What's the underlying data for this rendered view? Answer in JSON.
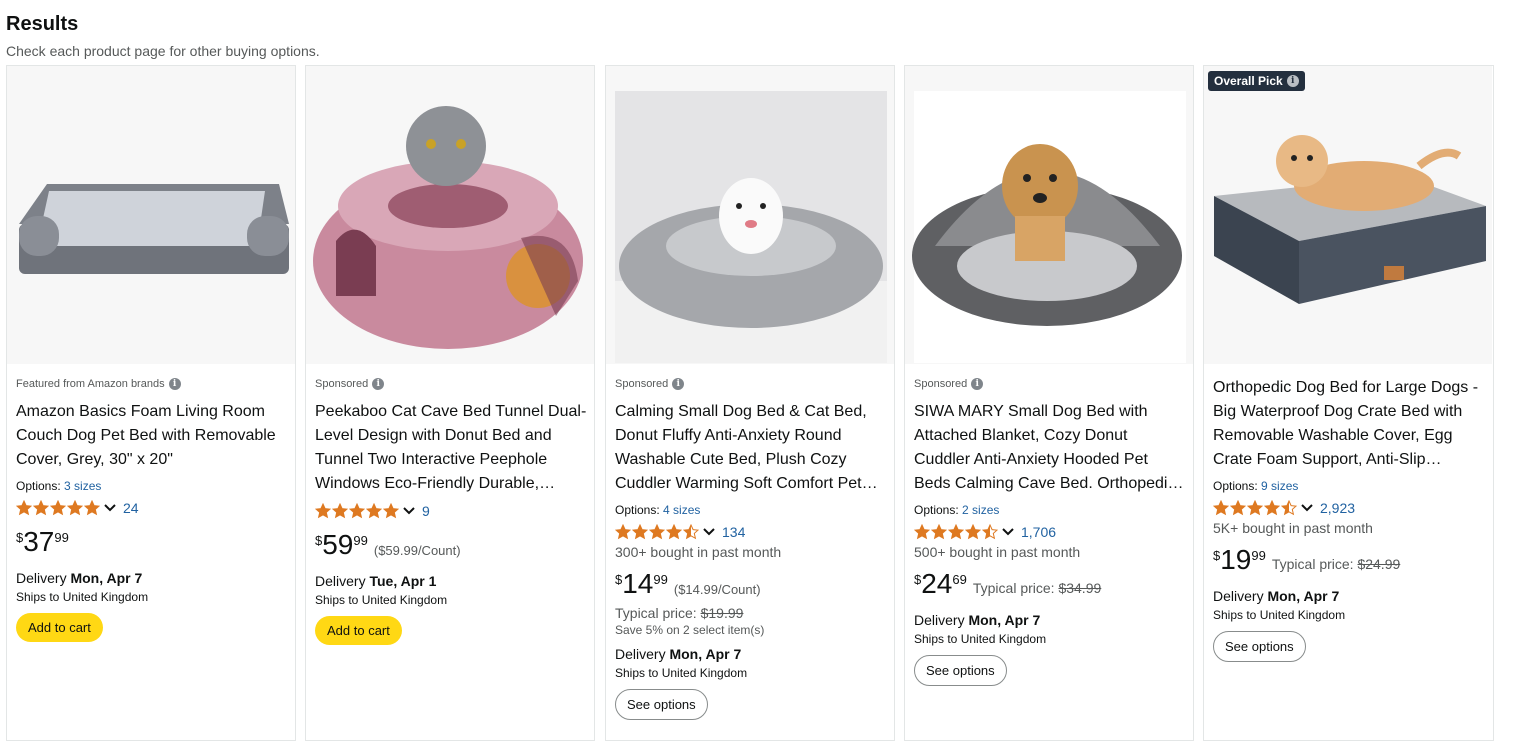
{
  "header": {
    "title": "Results",
    "subtitle": "Check each product page for other buying options."
  },
  "colors": {
    "star": "#de7921",
    "link": "#2162a1",
    "cart_button": "#ffd814",
    "badge": "#232f3e"
  },
  "products": [
    {
      "tag": "Featured from Amazon brands",
      "title": "Amazon Basics Foam Living Room Couch Dog Pet Bed with Removable Cover, Grey, 30\" x 20\"",
      "options_label": "Options:",
      "options_link": "3 sizes",
      "rating": 5,
      "review_count": "24",
      "price_symbol": "$",
      "price_whole": "37",
      "price_fraction": "99",
      "delivery_label": "Delivery",
      "delivery_date": "Mon, Apr 7",
      "ships": "Ships to United Kingdom",
      "button": "Add to cart",
      "image": "grey-foam-couch-dog-bed-image"
    },
    {
      "tag": "Sponsored",
      "title": "Peekaboo Cat Cave Bed Tunnel Dual-Level Design with Donut Bed and Tunnel Two Interactive Peephole Windows Eco-Friendly Durable, Eas…",
      "rating": 5,
      "review_count": "9",
      "price_symbol": "$",
      "price_whole": "59",
      "price_fraction": "99",
      "unit_price": "($59.99/Count)",
      "delivery_label": "Delivery",
      "delivery_date": "Tue, Apr 1",
      "ships": "Ships to United Kingdom",
      "button": "Add to cart",
      "image": "pink-cat-cave-bed-image"
    },
    {
      "tag": "Sponsored",
      "title": "Calming Small Dog Bed & Cat Bed, Donut Fluffy Anti-Anxiety Round Washable Cute Bed, Plush Cozy Cuddler Warming Soft Comfort Pet…",
      "options_label": "Options:",
      "options_link": "4 sizes",
      "rating": 4.5,
      "review_count": "134",
      "bought": "300+ bought in past month",
      "price_symbol": "$",
      "price_whole": "14",
      "price_fraction": "99",
      "unit_price": "($14.99/Count)",
      "typical_label": "Typical price:",
      "typical_price": "$19.99",
      "save_text": "Save 5% on 2 select item(s)",
      "delivery_label": "Delivery",
      "delivery_date": "Mon, Apr 7",
      "ships": "Ships to United Kingdom",
      "button": "See options",
      "image": "grey-fluffy-donut-bed-image"
    },
    {
      "tag": "Sponsored",
      "title": "SIWA MARY Small Dog Bed with Attached Blanket, Cozy Donut Cuddler Anti-Anxiety Hooded Pet Beds Calming Cave Bed. Orthopedi…",
      "options_label": "Options:",
      "options_link": "2 sizes",
      "rating": 4.5,
      "review_count": "1,706",
      "bought": "500+ bought in past month",
      "price_symbol": "$",
      "price_whole": "24",
      "price_fraction": "69",
      "typical_label": "Typical price:",
      "typical_price": "$34.99",
      "delivery_label": "Delivery",
      "delivery_date": "Mon, Apr 7",
      "ships": "Ships to United Kingdom",
      "button": "See options",
      "image": "hooded-cave-dog-bed-image"
    },
    {
      "badge": "Overall Pick",
      "title": "Orthopedic Dog Bed for Large Dogs - Big Waterproof Dog Crate Bed with Removable Washable Cover, Egg Crate Foam Support, Anti-Slip…",
      "options_label": "Options:",
      "options_link": "9 sizes",
      "rating": 4.5,
      "review_count": "2,923",
      "bought": "5K+ bought in past month",
      "price_symbol": "$",
      "price_whole": "19",
      "price_fraction": "99",
      "typical_label": "Typical price:",
      "typical_price": "$24.99",
      "delivery_label": "Delivery",
      "delivery_date": "Mon, Apr 7",
      "ships": "Ships to United Kingdom",
      "button": "See options",
      "image": "orthopedic-dog-bed-image"
    }
  ]
}
